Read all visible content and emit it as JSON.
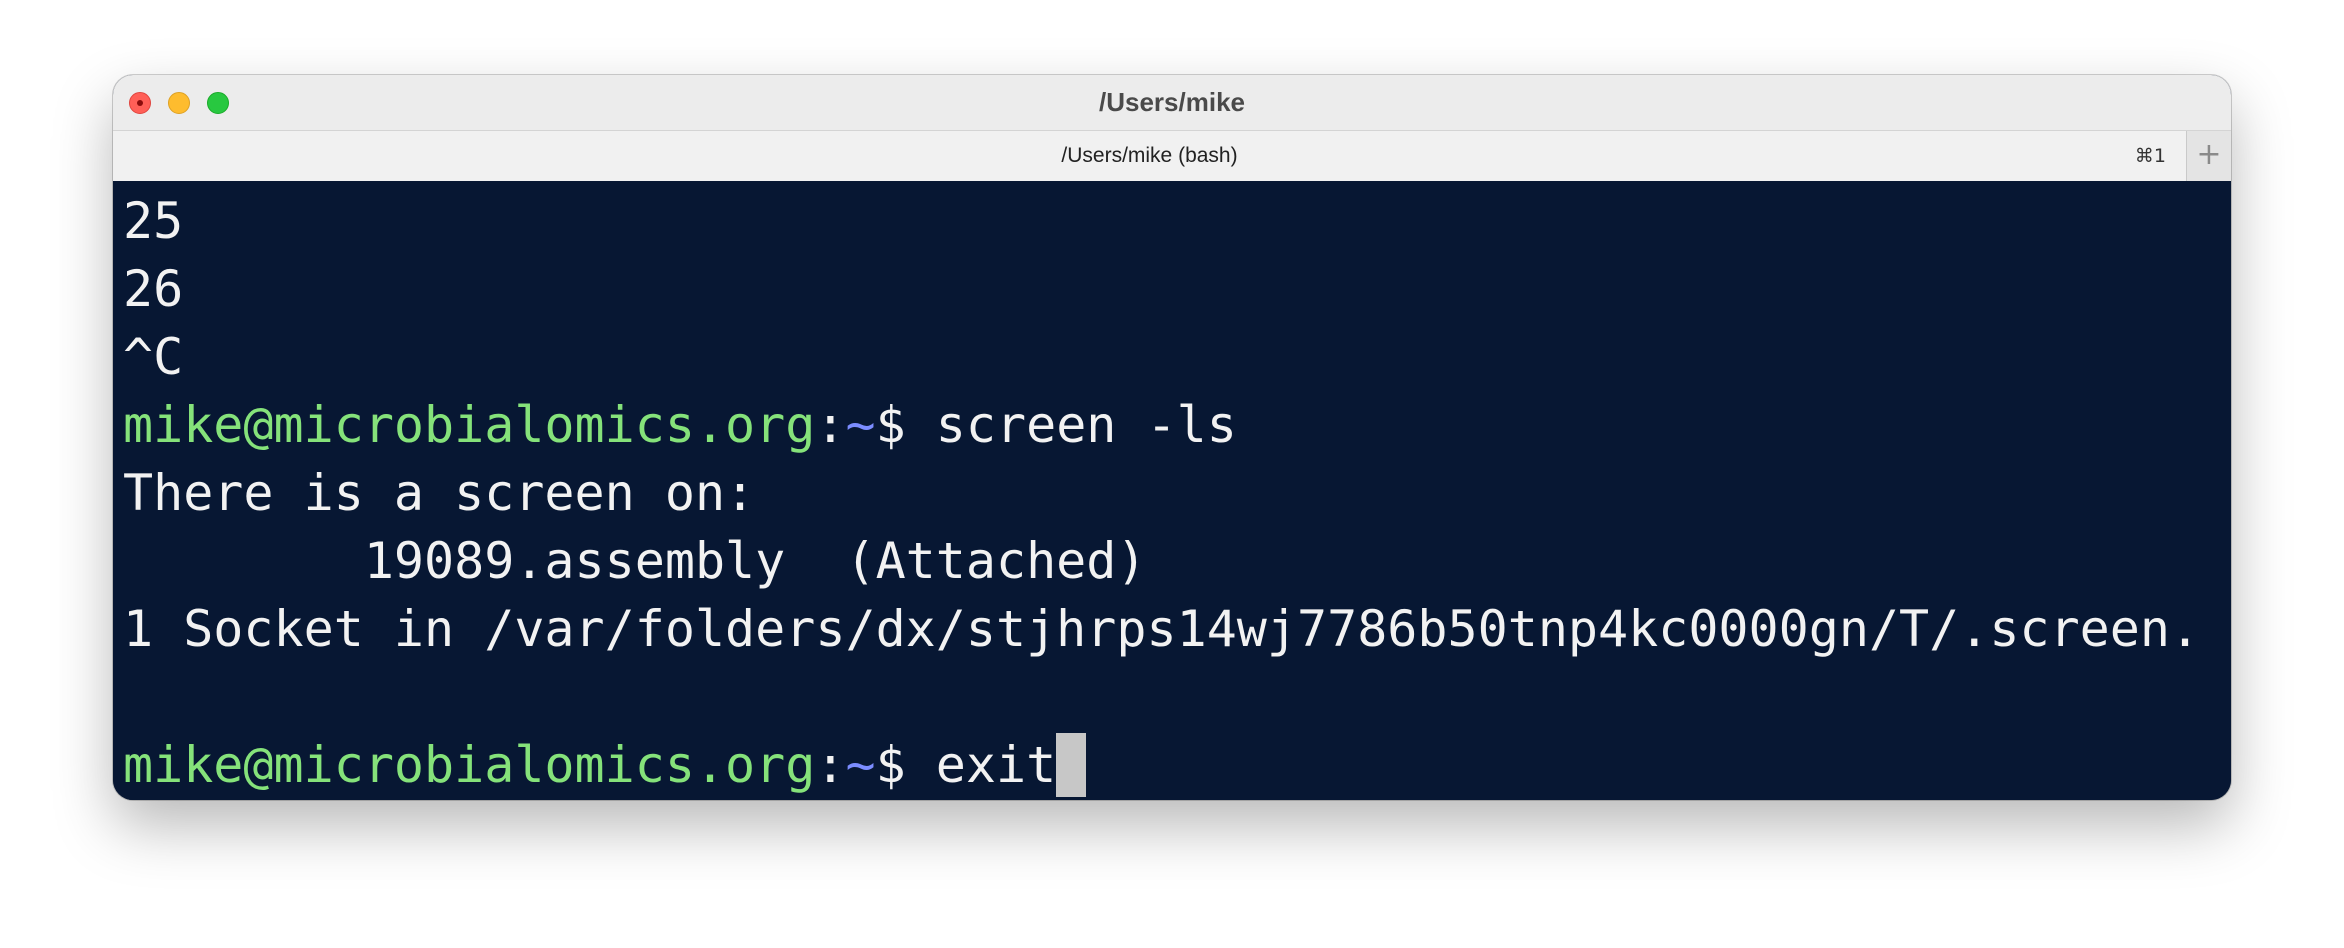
{
  "window": {
    "title": "/Users/mike"
  },
  "tab": {
    "title": "/Users/mike (bash)",
    "shortcut": "⌘1",
    "new_tab_label": "+"
  },
  "terminal": {
    "lines_before": [
      "25",
      "26",
      "^C"
    ],
    "prompt": {
      "user_host": "mike@microbialomics.org",
      "colon": ":",
      "dir": "~",
      "dollar": "$ "
    },
    "command_1": "screen -ls",
    "output": [
      "There is a screen on:",
      "        19089.assembly  (Attached)",
      "1 Socket in /var/folders/dx/stjhrps14wj7786b50tnp4kc0000gn/T/.screen.",
      ""
    ],
    "command_2": "exit"
  },
  "colors": {
    "background": "#071733",
    "foreground": "#f2f2f2",
    "prompt_user": "#85e27a",
    "prompt_dir": "#7b8cff",
    "cursor": "#c7c7c7"
  }
}
